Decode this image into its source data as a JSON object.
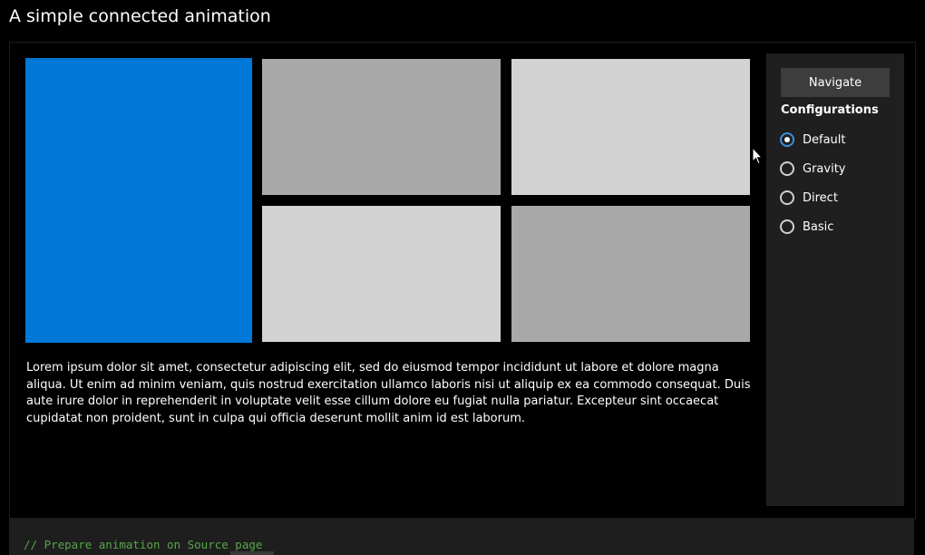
{
  "page": {
    "title": "A simple connected animation"
  },
  "gallery": {
    "tiles": [
      {
        "name": "hero",
        "color": "#0078d7"
      },
      {
        "name": "top-middle",
        "color": "#a9a9a9"
      },
      {
        "name": "top-right",
        "color": "#d3d3d3"
      },
      {
        "name": "bottom-middle",
        "color": "#d3d3d3"
      },
      {
        "name": "bottom-right",
        "color": "#a9a9a9"
      }
    ]
  },
  "content": {
    "body_text": "Lorem ipsum dolor sit amet, consectetur adipiscing elit, sed do eiusmod tempor incididunt ut labore et dolore magna aliqua. Ut enim ad minim veniam, quis nostrud exercitation ullamco laboris nisi ut aliquip ex ea commodo consequat. Duis aute irure dolor in reprehenderit in voluptate velit esse cillum dolore eu fugiat nulla pariatur. Excepteur sint occaecat cupidatat non proident, sunt in culpa qui officia deserunt mollit anim id est laborum."
  },
  "side_panel": {
    "navigate_label": "Navigate",
    "configurations_heading": "Configurations",
    "options": [
      {
        "label": "Default",
        "checked": true
      },
      {
        "label": "Gravity",
        "checked": false
      },
      {
        "label": "Direct",
        "checked": false
      },
      {
        "label": "Basic",
        "checked": false
      }
    ]
  },
  "code": {
    "first_line": "// Prepare animation on Source page"
  },
  "colors": {
    "accent": "#0078d7",
    "comment": "#57a64a",
    "panel": "#1f1f1f"
  }
}
